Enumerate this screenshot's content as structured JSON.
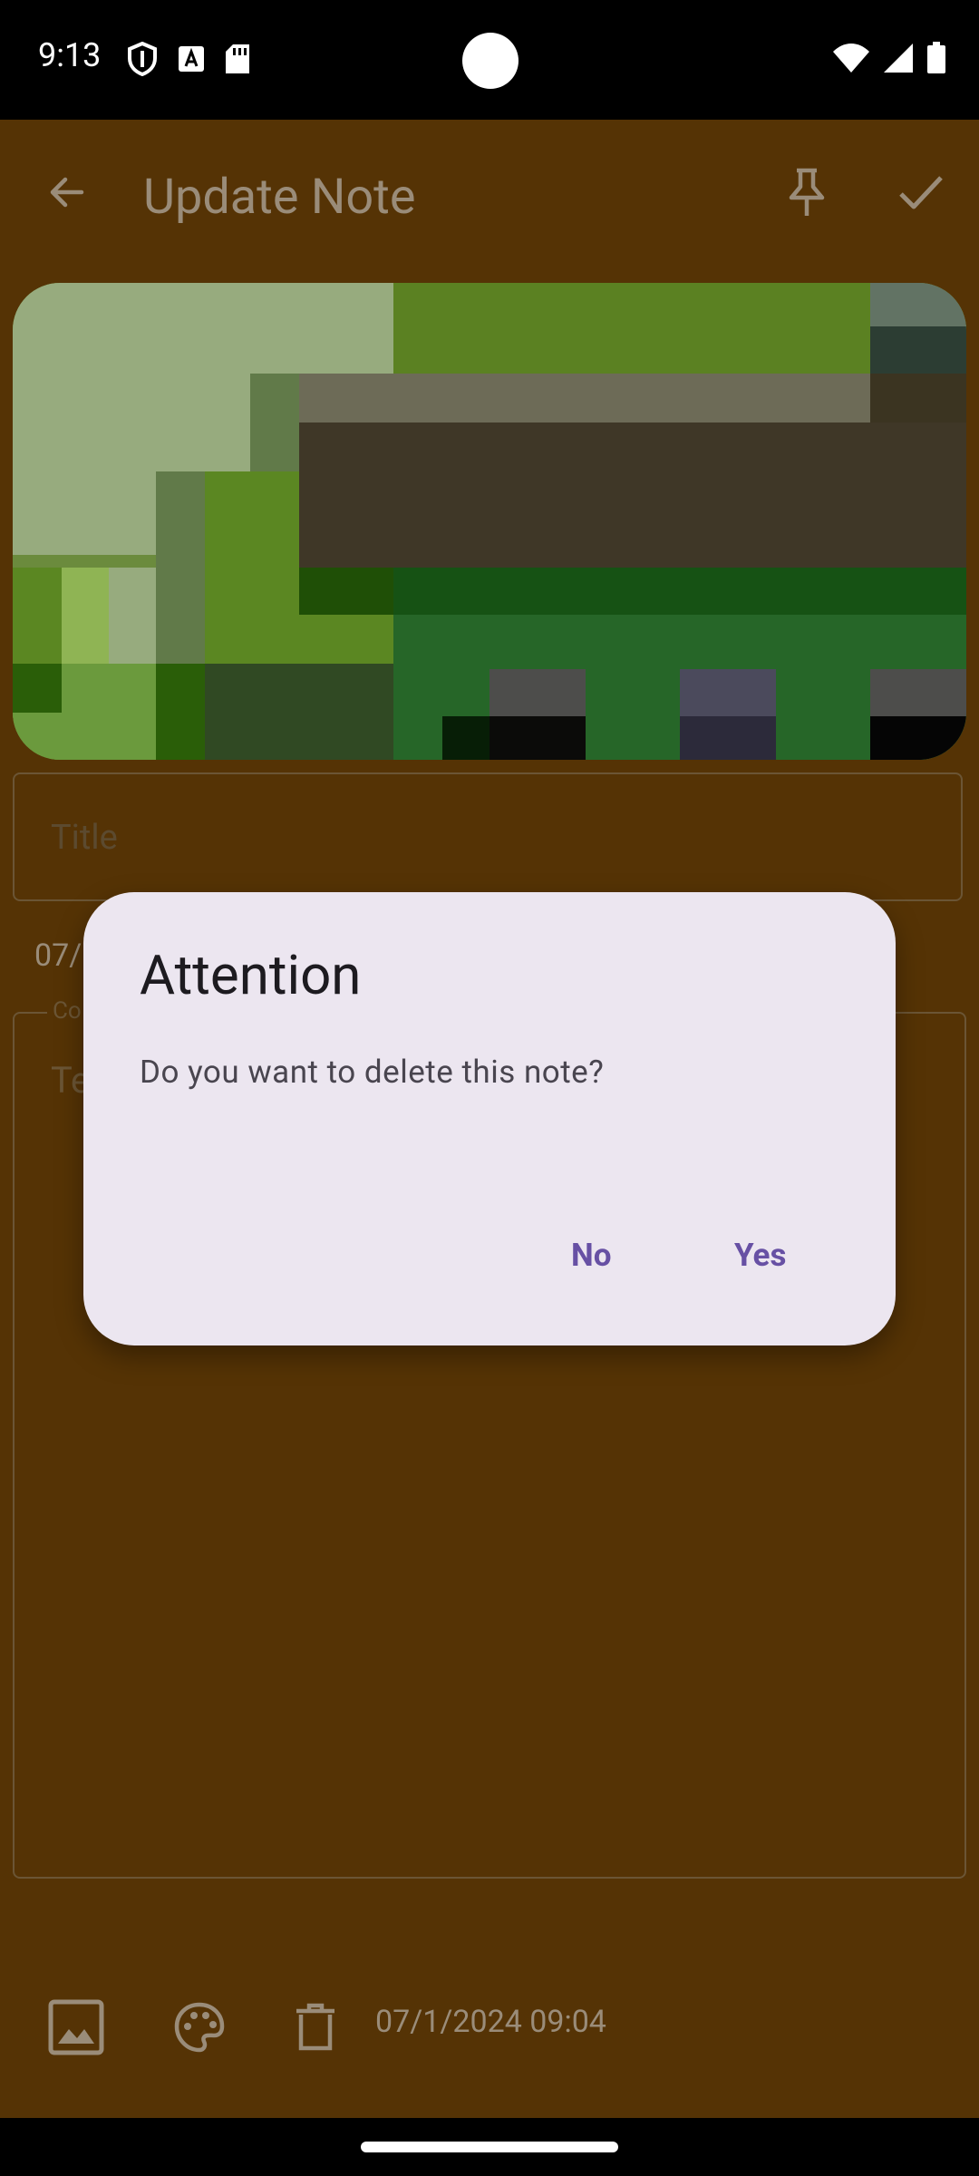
{
  "status_bar": {
    "time": "9:13",
    "icons_left": [
      "shield-icon",
      "font-a-icon",
      "sd-card-icon"
    ],
    "icons_right": [
      "wifi-icon",
      "cellular-signal-icon",
      "battery-icon"
    ]
  },
  "toolbar": {
    "title": "Update Note",
    "back_icon": "arrow-back-icon",
    "pin_icon": "pin-icon",
    "save_icon": "check-icon"
  },
  "note": {
    "title_placeholder": "Title",
    "date_partial": "07/",
    "content_label_partial": "Co",
    "content_placeholder_partial": "Te"
  },
  "bottom_bar": {
    "image_icon": "image-icon",
    "palette_icon": "palette-icon",
    "delete_icon": "delete-icon",
    "date": "07/1/2024 09:04"
  },
  "dialog": {
    "title": "Attention",
    "message": "Do you want to delete this note?",
    "no_label": "No",
    "yes_label": "Yes"
  },
  "colors": {
    "app_background": "#553305",
    "dialog_background": "#ece6f0",
    "dialog_accent": "#6750a4"
  }
}
